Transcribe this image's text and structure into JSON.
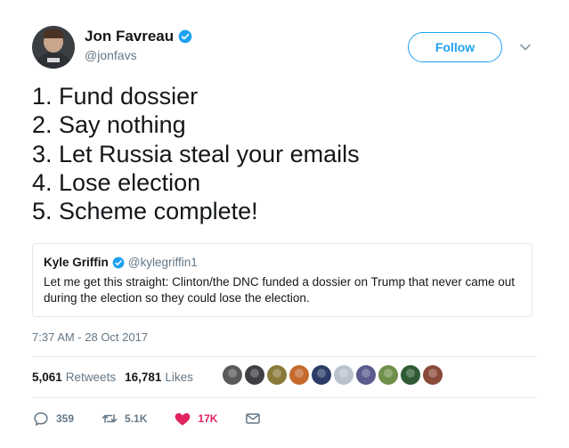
{
  "author": {
    "display_name": "Jon Favreau",
    "handle": "@jonfavs"
  },
  "follow_label": "Follow",
  "body_lines": [
    "1. Fund dossier",
    "2. Say nothing",
    "3. Let Russia steal your emails",
    "4. Lose election",
    "5. Scheme complete!"
  ],
  "quoted_tweet": {
    "display_name": "Kyle Griffin",
    "handle": "@kylegriffin1",
    "text": "Let me get this straight: Clinton/the DNC funded a dossier on Trump that never came out during the election so they could lose the election."
  },
  "timestamp": "7:37 AM - 28 Oct 2017",
  "stats": {
    "retweets_count": "5,061",
    "retweets_label": "Retweets",
    "likes_count": "16,781",
    "likes_label": "Likes"
  },
  "likers": [
    {
      "color": "#5a5a5a"
    },
    {
      "color": "#3d3f45"
    },
    {
      "color": "#8a7a3a"
    },
    {
      "color": "#c56a2c"
    },
    {
      "color": "#2b3c66"
    },
    {
      "color": "#b8c2cc"
    },
    {
      "color": "#5b5a8c"
    },
    {
      "color": "#6f8f4a"
    },
    {
      "color": "#2f5a34"
    },
    {
      "color": "#8a4a3a"
    }
  ],
  "actions": {
    "reply_count": "359",
    "retweet_count": "5.1K",
    "like_count": "17K"
  },
  "colors": {
    "accent": "#1da1f2",
    "like": "#e0245e",
    "secondary_text": "#657786",
    "border": "#e1e8ed"
  },
  "icons": {
    "verified": "verified-badge-icon",
    "caret": "chevron-down-icon",
    "reply": "reply-icon",
    "retweet": "retweet-icon",
    "like": "heart-icon",
    "dm": "envelope-icon"
  }
}
